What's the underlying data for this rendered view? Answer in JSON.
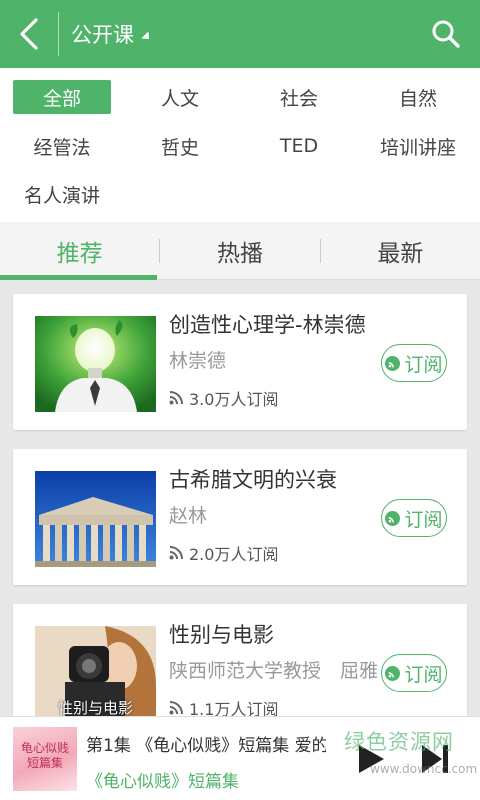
{
  "header": {
    "title": "公开课"
  },
  "categories": [
    "全部",
    "人文",
    "社会",
    "自然",
    "经管法",
    "哲史",
    "TED",
    "培训讲座",
    "名人演讲"
  ],
  "tabs": [
    "推荐",
    "热播",
    "最新"
  ],
  "courses": [
    {
      "title": "创造性心理学-林崇德",
      "author": "林崇德",
      "subs": "3.0万人订阅",
      "button": "订阅"
    },
    {
      "title": "古希腊文明的兴衰",
      "author": "赵林",
      "subs": "2.0万人订阅",
      "button": "订阅"
    },
    {
      "title": "性别与电影",
      "author": "陕西师范大学教授　屈雅...",
      "subs": "1.1万人订阅",
      "button": "订阅",
      "thumb_text": "性别与电影"
    }
  ],
  "player": {
    "title": "第1集 《龟心似贱》短篇集 爱的...",
    "subtitle": "《龟心似贱》短篇集",
    "cover_text": "龟心似贱短篇集"
  },
  "watermark": {
    "cn": "绿色资源网",
    "en": "www.downcc.com"
  },
  "colors": {
    "accent": "#4fb36a"
  },
  "icons": [
    "back-arrow-icon",
    "search-icon",
    "caret-icon",
    "rss-icon",
    "play-icon",
    "next-icon"
  ]
}
